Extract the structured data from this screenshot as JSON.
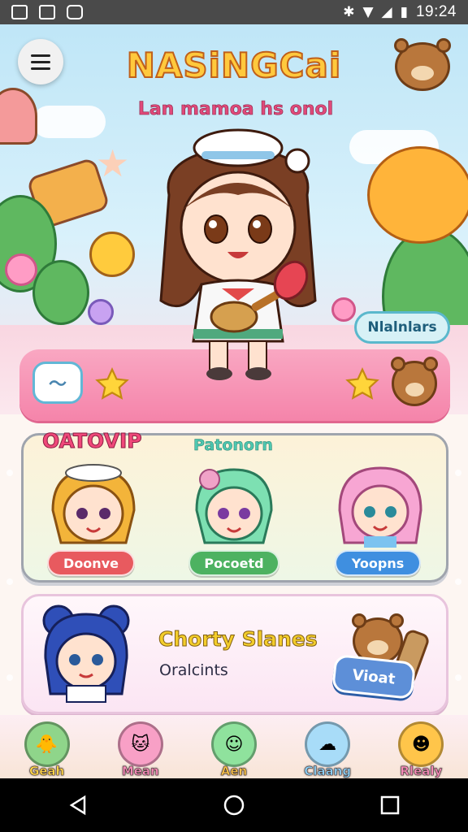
{
  "status_bar": {
    "time": "19:24"
  },
  "header": {
    "title": "NASiNGCai",
    "subtitle": "Lan mamoa hs onol"
  },
  "hero": {
    "badge_label": "Nlalnlars"
  },
  "characters_section": {
    "title": "OATOVIP",
    "subtitle": "Patonorn",
    "characters": [
      {
        "label": "Doonve",
        "color": "#e85a5f"
      },
      {
        "label": "Pocoetd",
        "color": "#4db261"
      },
      {
        "label": "Yoopns",
        "color": "#3f8fe0"
      }
    ]
  },
  "feature_card": {
    "title": "Chorty Slanes",
    "subtitle": "Oralcints",
    "button_label": "Vioat"
  },
  "bottom_nav": {
    "items": [
      {
        "label": "Geah",
        "color": "#8fd58a"
      },
      {
        "label": "Mean",
        "color": "#f8a0c6"
      },
      {
        "label": "Aen",
        "color": "#8fe29d"
      },
      {
        "label": "Claang",
        "color": "#a8dcf8"
      },
      {
        "label": "Rlealy",
        "color": "#ffc54a"
      }
    ]
  }
}
